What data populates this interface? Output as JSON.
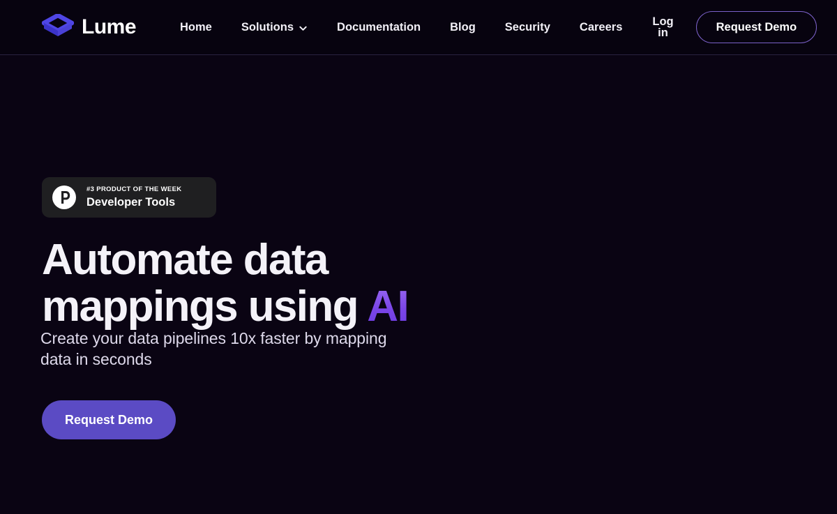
{
  "brand": {
    "name": "Lume",
    "logo_icon": "isometric-cube-logo",
    "logo_color": "#4f46e5"
  },
  "header": {
    "nav_items": [
      {
        "label": "Home",
        "has_dropdown": false
      },
      {
        "label": "Solutions",
        "has_dropdown": true,
        "dropdown_icon": "chevron-down-icon"
      },
      {
        "label": "Documentation",
        "has_dropdown": false
      },
      {
        "label": "Blog",
        "has_dropdown": false
      },
      {
        "label": "Security",
        "has_dropdown": false
      },
      {
        "label": "Careers",
        "has_dropdown": false
      }
    ],
    "login_label": "Log in",
    "demo_label": "Request Demo",
    "demo_border_color": "#7b61c9"
  },
  "hero": {
    "badge": {
      "icon": "product-hunt-icon",
      "kicker": "#3 PRODUCT OF THE WEEK",
      "title": "Developer Tools",
      "background": "#1f1f21"
    },
    "title_line1": "Automate data",
    "title_line2_prefix": "mappings using ",
    "title_accent": "AI",
    "accent_color": "#8b5cf6",
    "subtitle": "Create your data pipelines 10x faster by mapping data in seconds",
    "cta_label": "Request Demo",
    "cta_color": "#5b4bc4"
  },
  "theme": {
    "page_background": "#0a0413",
    "header_background": "#07030f",
    "header_border": "#2a2340",
    "text_primary": "#f4f2f8",
    "text_secondary": "#ded9eb"
  }
}
